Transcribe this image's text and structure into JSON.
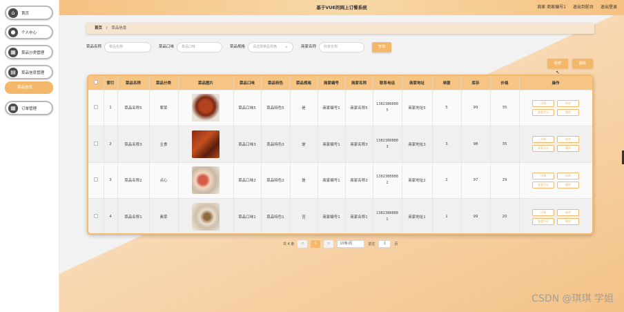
{
  "app": {
    "title": "基于VUE的网上订餐系统"
  },
  "topbar": {
    "user_info": "商家 商家编号1",
    "back_label": "退出到前台",
    "logout_label": "退出登录"
  },
  "sidebar": {
    "items": [
      {
        "label": "首页",
        "icon": "home-icon"
      },
      {
        "label": "个人中心",
        "icon": "user-icon"
      },
      {
        "label": "菜品分类管理",
        "icon": "grid-icon"
      },
      {
        "label": "菜品信息管理",
        "icon": "dish-icon"
      },
      {
        "label": "订单管理",
        "icon": "grid-icon"
      }
    ],
    "active_sub": "菜品信息"
  },
  "breadcrumb": {
    "home": "首页",
    "separator": "/",
    "current": "菜品信息"
  },
  "search": {
    "name_label": "菜品名称",
    "name_placeholder": "菜品名称",
    "taste_label": "菜品口味",
    "taste_placeholder": "菜品口味",
    "type_label": "菜品规格",
    "type_placeholder": "请选择菜品规格",
    "shop_label": "商家名称",
    "shop_placeholder": "商家名称",
    "search_button": "查询"
  },
  "actions": {
    "add_button": "新增",
    "delete_button": "删除"
  },
  "table": {
    "headers": [
      "",
      "索引",
      "菜品名称",
      "菜品分类",
      "菜品图片",
      "菜品口味",
      "菜品特色",
      "菜品规格",
      "商家编号",
      "商家名称",
      "联系电话",
      "商家地址",
      "单服",
      "库存",
      "价格",
      "操作"
    ],
    "rows": [
      {
        "index": "1",
        "name": "菜品名称5",
        "category": "荤菜",
        "taste": "菜品口味5",
        "feature": "菜品特色5",
        "spec": "是",
        "shop_no": "商家编号1",
        "shop_name": "商家名称5",
        "phone": "13823888885",
        "address": "商家地址5",
        "single": "5",
        "stock": "99",
        "price": "35"
      },
      {
        "index": "2",
        "name": "菜品名称3",
        "category": "主食",
        "taste": "菜品口味3",
        "feature": "菜品特色3",
        "spec": "是",
        "shop_no": "商家编号1",
        "shop_name": "商家名称3",
        "phone": "13823888883",
        "address": "商家地址3",
        "single": "3",
        "stock": "98",
        "price": "35"
      },
      {
        "index": "3",
        "name": "菜品名称2",
        "category": "点心",
        "taste": "菜品口味2",
        "feature": "菜品特色2",
        "spec": "是",
        "shop_no": "商家编号1",
        "shop_name": "商家名称2",
        "phone": "13823888882",
        "address": "商家地址2",
        "single": "2",
        "stock": "97",
        "price": "29"
      },
      {
        "index": "4",
        "name": "菜品名称1",
        "category": "素菜",
        "taste": "菜品口味1",
        "feature": "菜品特色1",
        "spec": "否",
        "shop_no": "商家编号1",
        "shop_name": "商家名称1",
        "phone": "13823888881",
        "address": "商家地址1",
        "single": "1",
        "stock": "99",
        "price": "20"
      }
    ],
    "row_actions": {
      "detail": "详情",
      "edit": "修改",
      "review": "查看评论",
      "delete": "删除"
    }
  },
  "pagination": {
    "total": "共 4 条",
    "prev": "<",
    "current_page": "1",
    "next": ">",
    "page_size": "10条/页",
    "jump_label": "前往",
    "jump_value": "1",
    "page_unit": "页"
  },
  "watermark": "CSDN @琪琪 学姐",
  "colors": {
    "accent": "#f3b86a",
    "topbar": "#f6c180",
    "header_row": "#f6c584"
  }
}
